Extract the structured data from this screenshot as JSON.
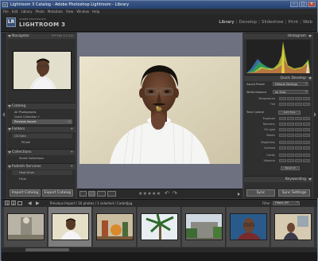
{
  "window": {
    "title": "Lightroom 3 Catalog - Adobe Photoshop Lightroom - Library",
    "app_badge": "LR"
  },
  "menu": [
    "File",
    "Edit",
    "Library",
    "Photo",
    "Metadata",
    "View",
    "Window",
    "Help"
  ],
  "identity": {
    "badge": "LR",
    "subtitle": "ADOBE PHOTOSHOP",
    "name": "LIGHTROOM 3"
  },
  "modules": [
    "Library",
    "Develop",
    "Slideshow",
    "Print",
    "Web"
  ],
  "active_module": "Library",
  "left": {
    "navigator": {
      "title": "Navigator",
      "options": "FIT FILL 1:1 3:1"
    },
    "catalog": {
      "title": "Catalog",
      "items": [
        {
          "label": "All Photographs",
          "count": ""
        },
        {
          "label": "Quick Collection +",
          "count": ""
        },
        {
          "label": "Previous Import",
          "count": "16"
        }
      ]
    },
    "folders": {
      "title": "Folders",
      "items": [
        {
          "label": "CD Data",
          "count": ""
        },
        {
          "label": "PICtell",
          "count": ""
        }
      ]
    },
    "collections": {
      "title": "Collections",
      "items": [
        {
          "label": "Smart Collections",
          "count": ""
        }
      ]
    },
    "publish": {
      "title": "Publish Services",
      "items": [
        {
          "label": "Hard Drive",
          "count": ""
        },
        {
          "label": "Flickr",
          "count": ""
        }
      ]
    },
    "import_label": "Import Catalog",
    "export_label": "Export Catalog"
  },
  "right": {
    "histogram": {
      "title": "Histogram"
    },
    "quick_develop": {
      "title": "Quick Develop",
      "saved_preset": {
        "label": "Saved Preset",
        "value": "Default Settings"
      },
      "white_balance": {
        "label": "White Balance",
        "value": "As Shot"
      },
      "wb_sliders": [
        "Temperature",
        "Tint"
      ],
      "tone_control": {
        "label": "Tone Control",
        "button": "Auto Tone"
      },
      "tone_sliders": [
        "Exposure",
        "Recovery",
        "Fill Light",
        "Blacks",
        "Brightness",
        "Contrast",
        "Clarity",
        "Vibrance"
      ],
      "reset_all": "Reset All"
    },
    "keywording": {
      "title": "Keywording"
    },
    "sync_label": "Sync",
    "sync_settings_label": "Sync Settings"
  },
  "toolbar": {
    "stars": "★★★★★"
  },
  "filmstrip": {
    "page_numbers": [
      "1",
      "2"
    ],
    "source": "Previous Import / 16 photos / 1 selected / Carbetjpg",
    "filter_label": "Filter :",
    "filter_value": "Filters Off",
    "selected_index": 1,
    "thumbnails": [
      {
        "name": "statue"
      },
      {
        "name": "man-eating"
      },
      {
        "name": "still-life"
      },
      {
        "name": "palm-tree"
      },
      {
        "name": "building"
      },
      {
        "name": "man-glasses"
      },
      {
        "name": "room-portrait"
      }
    ]
  }
}
